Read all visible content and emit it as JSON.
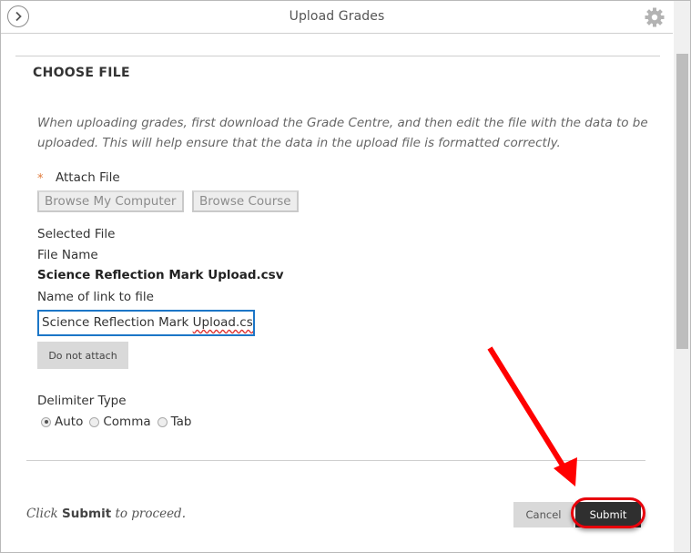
{
  "header": {
    "title": "Upload Grades",
    "back_icon": "chevron-right-circle-icon",
    "settings_icon": "gear-icon"
  },
  "section": {
    "title": "CHOOSE FILE",
    "instructions": "When uploading grades, first download the Grade Centre, and then edit the file with the data to be uploaded. This will help ensure that the data in the upload file is formatted correctly."
  },
  "attach": {
    "required_marker": "*",
    "label": "Attach File",
    "browse_computer": "Browse My Computer",
    "browse_course": "Browse Course"
  },
  "selected": {
    "heading": "Selected File",
    "file_name_label": "File Name",
    "file_name": "Science Reflection Mark Upload.csv",
    "link_label": "Name of link to file",
    "link_value_prefix": "Science Reflection Mark ",
    "link_value_misspelled": "Upload.csv",
    "link_value": "Science Reflection Mark Upload.csv",
    "do_not_attach": "Do not attach"
  },
  "delimiter": {
    "label": "Delimiter Type",
    "options": [
      {
        "label": "Auto",
        "checked": true
      },
      {
        "label": "Comma",
        "checked": false
      },
      {
        "label": "Tab",
        "checked": false
      }
    ]
  },
  "footer": {
    "proceed_prefix": "Click ",
    "proceed_bold": "Submit",
    "proceed_suffix": " to proceed.",
    "cancel": "Cancel",
    "submit": "Submit"
  },
  "annotation": {
    "color": "#ff0000",
    "target": "submit-button"
  }
}
